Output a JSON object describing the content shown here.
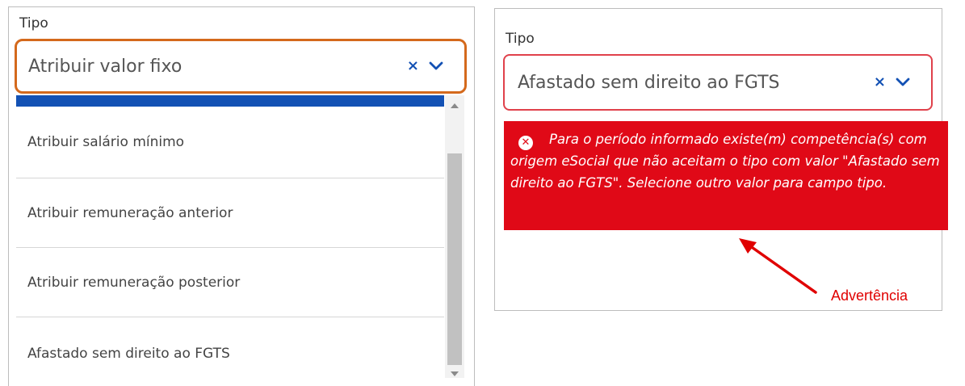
{
  "left": {
    "label": "Tipo",
    "select_value": "Atribuir valor fixo",
    "clear_symbol": "×",
    "options": [
      "Atribuir salário mínimo",
      "Atribuir remuneração anterior",
      "Atribuir remuneração posterior",
      "Afastado sem direito ao FGTS"
    ]
  },
  "right": {
    "label": "Tipo",
    "select_value": "Afastado sem direito ao FGTS",
    "clear_symbol": "×",
    "error_message": "Para o período informado existe(m) competência(s) com origem eSocial que não aceitam o tipo com valor \"Afastado sem direito ao FGTS\". Selecione outro valor para campo tipo."
  },
  "annotation": {
    "text": "Advertência"
  },
  "colors": {
    "focus_border": "#d4691c",
    "error_red": "#e00917",
    "accent_blue": "#1351b4",
    "annotation_red": "#e00000"
  }
}
